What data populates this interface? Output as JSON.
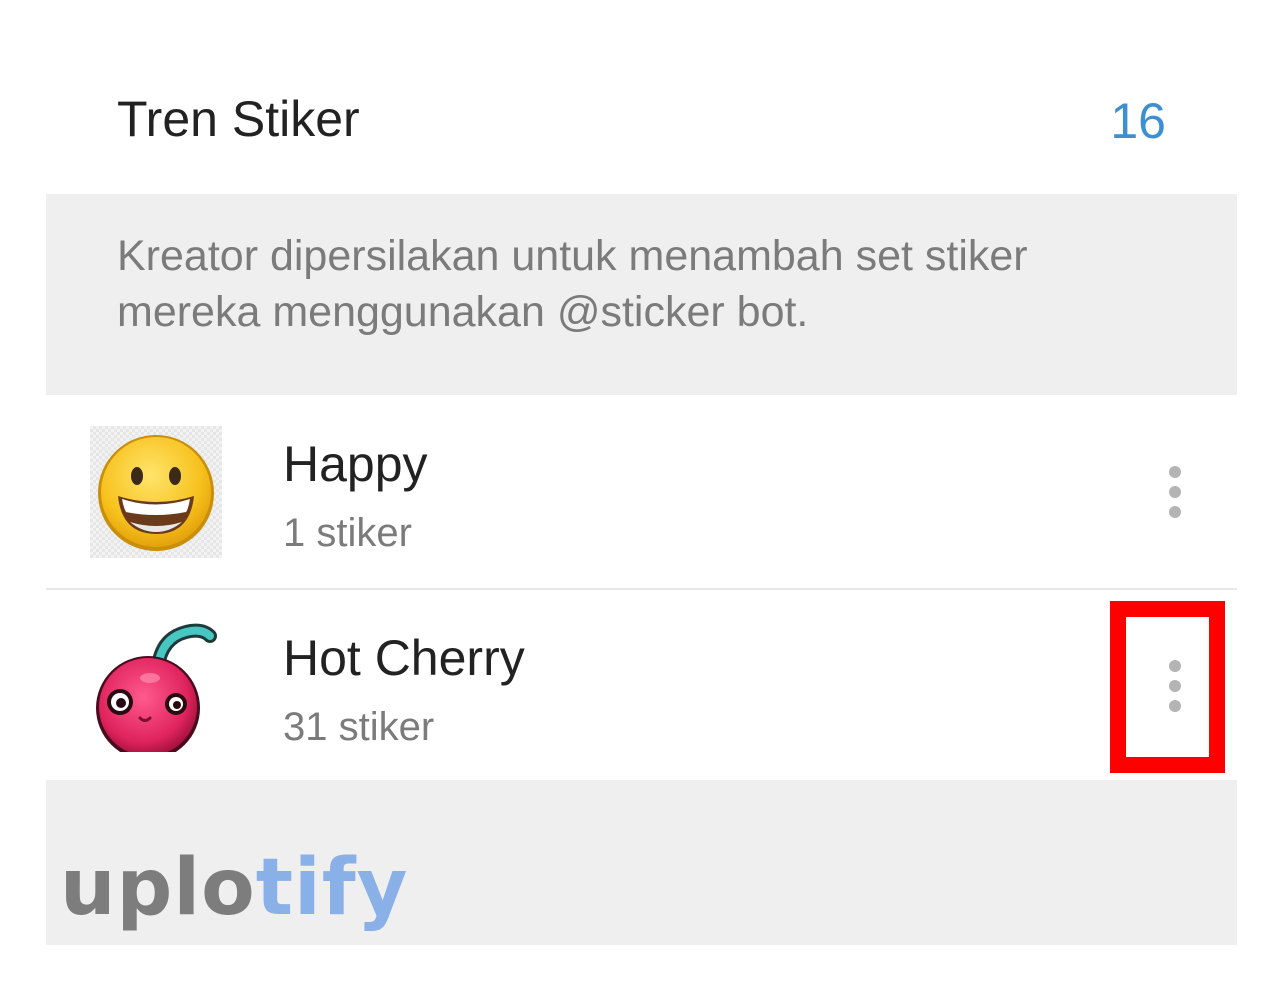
{
  "header": {
    "title": "Tren Stiker",
    "count": "16",
    "accent_color": "#3d8fd1"
  },
  "info": {
    "text": "Kreator dipersilakan untuk menambah set stiker mereka menggunakan @sticker bot."
  },
  "sticker_sets": [
    {
      "name": "Happy",
      "count": "1 stiker",
      "thumb_icon": "happy-emoji-icon",
      "menu_icon": "more-vert-icon"
    },
    {
      "name": "Hot Cherry",
      "count": "31 stiker",
      "thumb_icon": "cherry-sticker-icon",
      "menu_icon": "more-vert-icon",
      "highlighted": true
    }
  ],
  "highlight_color": "#ff0000",
  "watermark": {
    "part1": "uplo",
    "part2": "tify"
  }
}
